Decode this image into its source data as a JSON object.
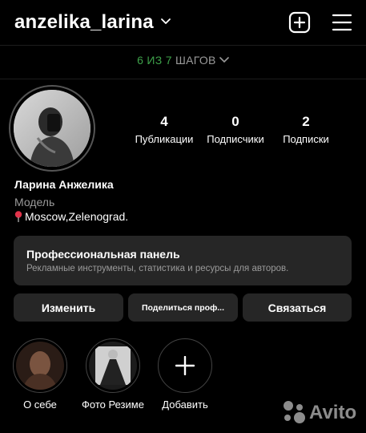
{
  "header": {
    "username": "anzelika_larina",
    "icons": [
      "chevron-down-icon",
      "add-post-icon",
      "menu-icon"
    ]
  },
  "steps": {
    "progress": "6 ИЗ 7",
    "label": "ШАГОВ"
  },
  "profile": {
    "stats": [
      {
        "value": "4",
        "label": "Публикации"
      },
      {
        "value": "0",
        "label": "Подписчики"
      },
      {
        "value": "2",
        "label": "Подписки"
      }
    ],
    "name": "Ларина Анжелика",
    "category": "Модель",
    "location": "Moscow,Zelenograd."
  },
  "pro_panel": {
    "title": "Профессиональная панель",
    "subtitle": "Рекламные инструменты, статистика и ресурсы для авторов."
  },
  "buttons": {
    "edit": "Изменить",
    "share": "Поделиться проф...",
    "contact": "Связаться"
  },
  "highlights": [
    {
      "label": "О себе"
    },
    {
      "label": "Фото Резиме"
    },
    {
      "label": "Добавить"
    }
  ],
  "watermark": {
    "text": "Avito"
  },
  "colors": {
    "accent_green": "#3ea14a",
    "panel": "#262626",
    "background": "#000000"
  }
}
